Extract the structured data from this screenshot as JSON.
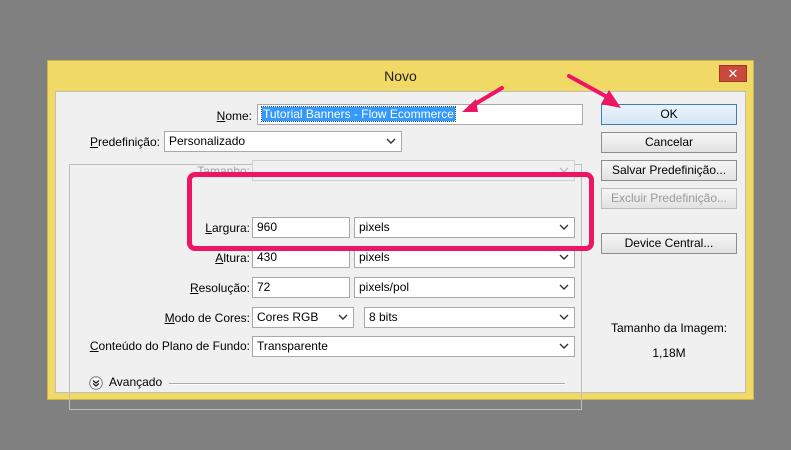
{
  "window": {
    "title": "Novo",
    "close_glyph": "✕"
  },
  "form": {
    "name_label_u": "N",
    "name_label_rest": "ome:",
    "name_value": "Tutorial Banners - Flow Ecommerce",
    "preset_label_u": "P",
    "preset_label_rest": "redefinição:",
    "preset_value": "Personalizado",
    "size_label": "Tamanho:",
    "width_label_u": "L",
    "width_label_rest": "argura:",
    "width_value": "960",
    "width_unit": "pixels",
    "height_label_u": "A",
    "height_label_rest": "ltura:",
    "height_value": "430",
    "height_unit": "pixels",
    "resolution_label_u": "R",
    "resolution_label_rest": "esolução:",
    "resolution_value": "72",
    "resolution_unit": "pixels/pol",
    "color_mode_label_u": "M",
    "color_mode_label_rest": "odo de Cores:",
    "color_mode_value": "Cores RGB",
    "bit_depth_value": "8 bits",
    "background_label_u": "C",
    "background_label_rest": "onteúdo do Plano de Fundo:",
    "background_value": "Transparente",
    "advanced_label": "Avançado"
  },
  "buttons": {
    "ok": "OK",
    "cancel": "Cancelar",
    "save_preset": "Salvar Predefinição...",
    "delete_preset": "Excluir Predefinição...",
    "device_central": "Device Central..."
  },
  "image_size": {
    "label": "Tamanho da Imagem:",
    "value": "1,18M"
  },
  "colors": {
    "annotation": "#ee1565",
    "window_frame": "#f0d964",
    "selection": "#3399ff"
  }
}
